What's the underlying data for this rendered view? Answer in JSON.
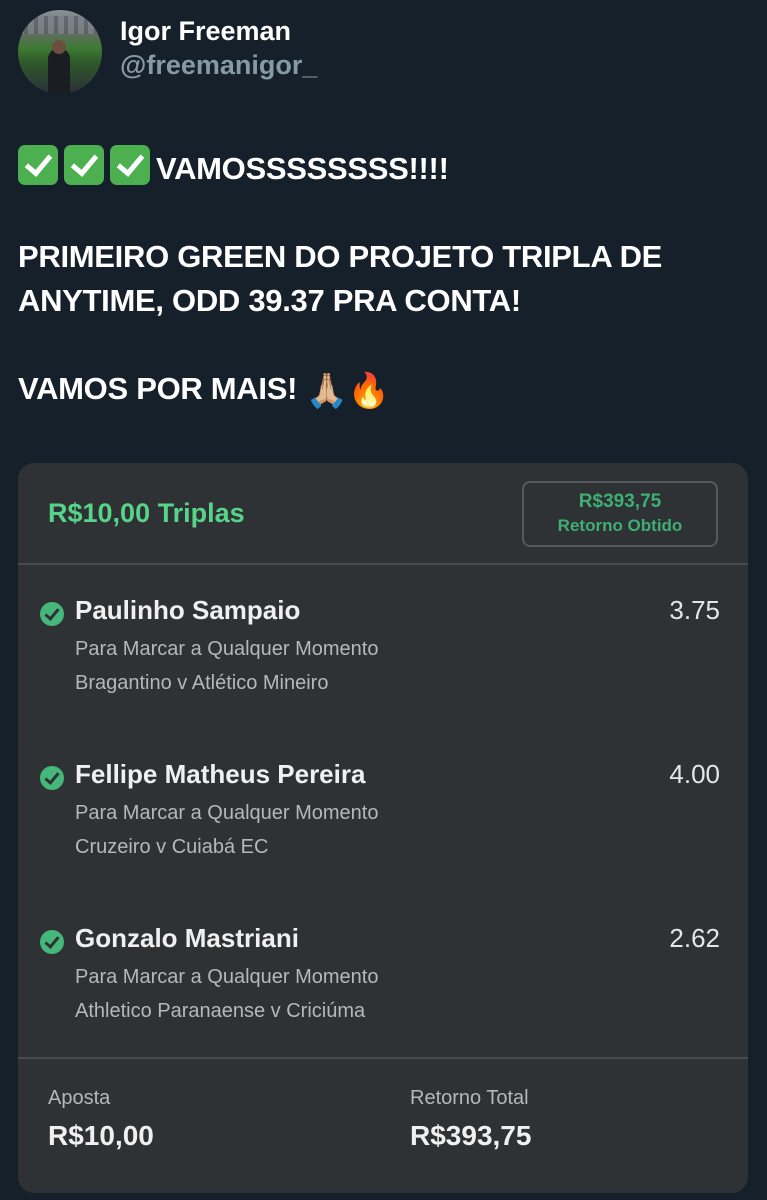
{
  "author": {
    "display_name": "Igor Freeman",
    "handle": "@freemanigor_"
  },
  "tweet": {
    "line1_emoji": [
      "check-mark-button",
      "check-mark-button",
      "check-mark-button"
    ],
    "line1_text": "VAMOSSSSSSSS!!!!",
    "paragraph2_line1": "PRIMEIRO GREEN DO PROJETO TRIPLA DE",
    "paragraph2_line2": "ANYTIME, ODD 39.37 PRA CONTA!",
    "paragraph3_text": "VAMOS POR MAIS!",
    "paragraph3_emoji_1": "🙏🏼",
    "paragraph3_emoji_2": "🔥"
  },
  "bet_slip": {
    "title": "R$10,00 Triplas",
    "return_amount": "R$393,75",
    "return_label": "Retorno Obtido",
    "selections": [
      {
        "name": "Paulinho Sampaio",
        "odd": "3.75",
        "market": "Para Marcar a Qualquer Momento",
        "match": "Bragantino v Atlético Mineiro"
      },
      {
        "name": "Fellipe Matheus Pereira",
        "odd": "4.00",
        "market": "Para Marcar a Qualquer Momento",
        "match": "Cruzeiro v Cuiabá EC"
      },
      {
        "name": "Gonzalo Mastriani",
        "odd": "2.62",
        "market": "Para Marcar a Qualquer Momento",
        "match": "Athletico Paranaense v Criciúma"
      }
    ],
    "stake_label": "Aposta",
    "stake_value": "R$10,00",
    "total_return_label": "Retorno Total",
    "total_return_value": "R$393,75"
  },
  "colors": {
    "background": "#15202b",
    "handle": "#8899a6",
    "slip_background": "#2e3234",
    "slip_accent_green": "#58d38a",
    "check_green": "#45b77a"
  }
}
